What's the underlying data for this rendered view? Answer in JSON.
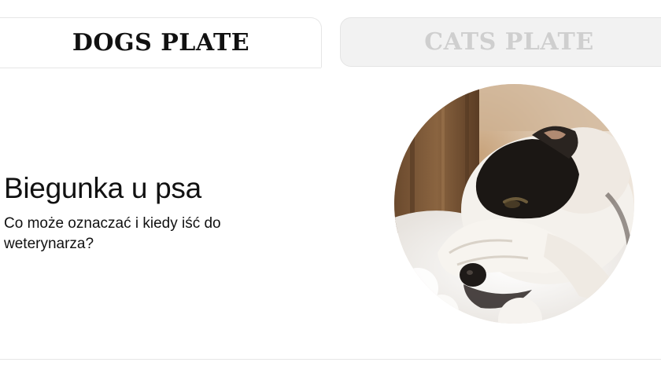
{
  "tabs": [
    {
      "label": "DOGS PLATE",
      "active": true
    },
    {
      "label": "CATS PLATE",
      "active": false
    }
  ],
  "article": {
    "title": "Biegunka u psa",
    "subtitle": "Co może oznaczać i kiedy iść do weterynarza?",
    "image_icon": "sleeping-dog-photo"
  },
  "colors": {
    "active_tab_text": "#111111",
    "inactive_tab_text": "#cfcfcf",
    "inactive_tab_bg": "#f2f2f2",
    "divider": "#e6e6e6"
  }
}
